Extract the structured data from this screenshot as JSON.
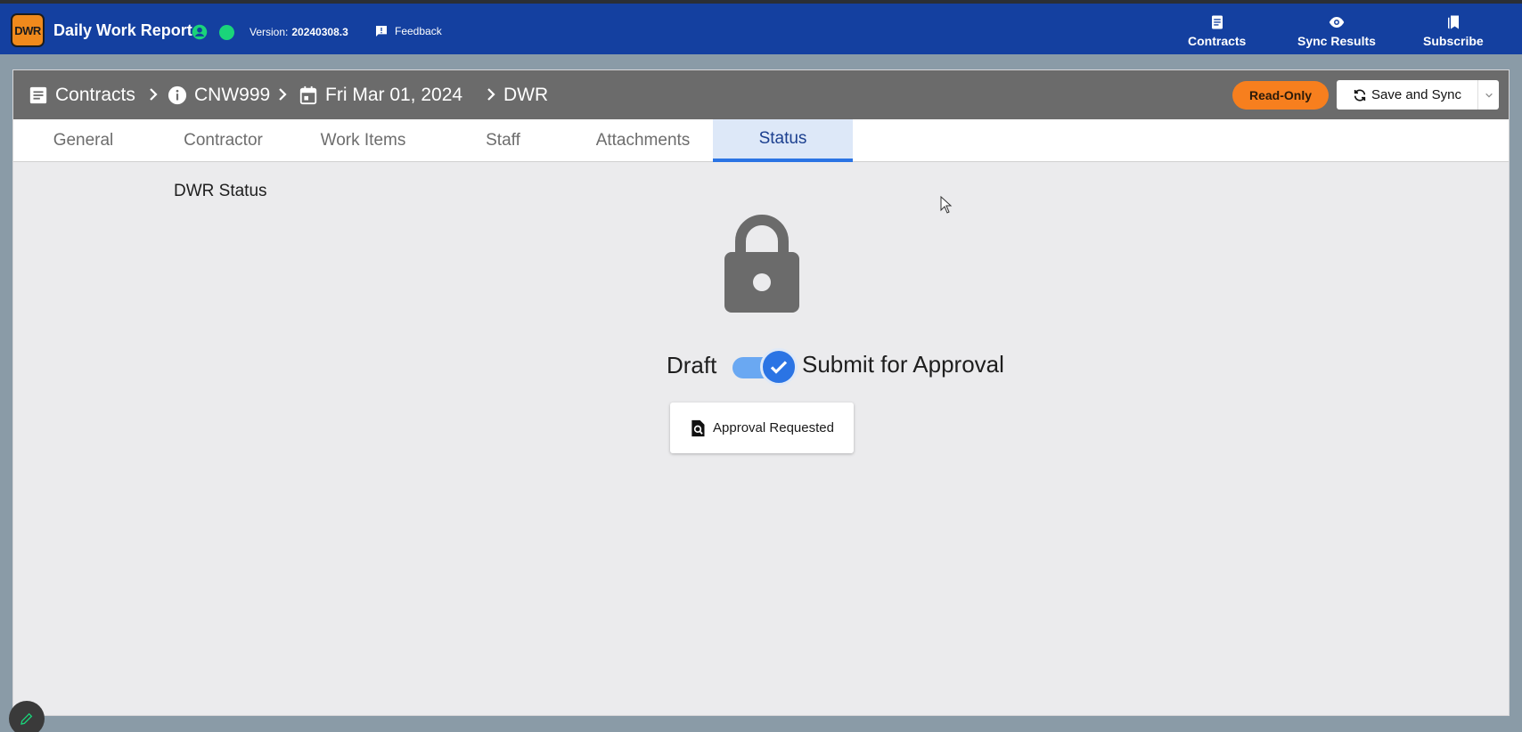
{
  "app": {
    "logo_text": "DWR",
    "title": "Daily Work Report",
    "version_label": "Version:",
    "version_number": "20240308.3",
    "feedback_label": "Feedback"
  },
  "nav": {
    "contracts": "Contracts",
    "sync_results": "Sync Results",
    "subscribe": "Subscribe"
  },
  "breadcrumb": {
    "contracts": "Contracts",
    "contract_id": "CNW999",
    "date": "Fri Mar 01, 2024",
    "report": "DWR"
  },
  "header_actions": {
    "read_only": "Read-Only",
    "save_sync": "Save and Sync"
  },
  "tabs": [
    {
      "label": "General"
    },
    {
      "label": "Contractor"
    },
    {
      "label": "Work Items"
    },
    {
      "label": "Staff"
    },
    {
      "label": "Attachments"
    },
    {
      "label": "Status",
      "active": true
    }
  ],
  "status": {
    "section_title": "DWR Status",
    "draft_label": "Draft",
    "submit_label": "Submit for Approval",
    "toggle_on": true,
    "approval_button": "Approval Requested"
  },
  "colors": {
    "appbar": "#1440a0",
    "header": "#6b6b6b",
    "accent": "#2b74e4",
    "readonly": "#f77f1e",
    "online": "#1ad47a"
  }
}
